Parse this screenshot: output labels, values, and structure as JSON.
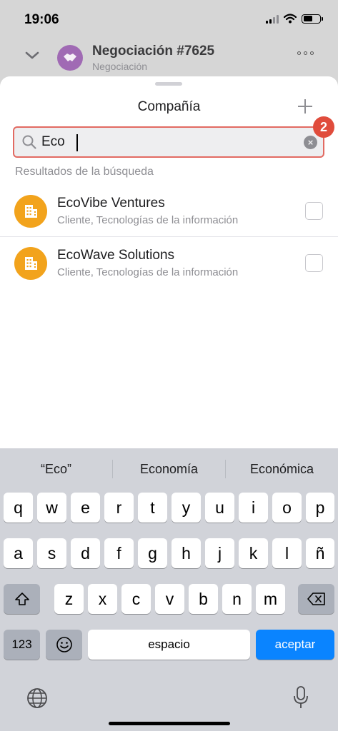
{
  "status_bar": {
    "time": "19:06"
  },
  "deal": {
    "title": "Negociación #7625",
    "subtitle": "Negociación",
    "avatar_color": "#a06ab4"
  },
  "sheet": {
    "title": "Compañía",
    "search": {
      "value": "Eco",
      "placeholder": ""
    },
    "badge": "2",
    "results_label": "Resultados de la búsqueda",
    "results": [
      {
        "name": "EcoVibe Ventures",
        "meta": "Cliente, Tecnologías de la información"
      },
      {
        "name": "EcoWave Solutions",
        "meta": "Cliente, Tecnologías de la información"
      }
    ]
  },
  "keyboard": {
    "suggestions": [
      "“Eco”",
      "Economía",
      "Económica"
    ],
    "row1": [
      "q",
      "w",
      "e",
      "r",
      "t",
      "y",
      "u",
      "i",
      "o",
      "p"
    ],
    "row2": [
      "a",
      "s",
      "d",
      "f",
      "g",
      "h",
      "j",
      "k",
      "l",
      "ñ"
    ],
    "row3": [
      "z",
      "x",
      "c",
      "v",
      "b",
      "n",
      "m"
    ],
    "numbers_key": "123",
    "space_key": "espacio",
    "return_key": "aceptar"
  },
  "colors": {
    "accent": "#0a84ff",
    "badge": "#e04c3c",
    "company_avatar": "#f2a31c",
    "search_border": "#e26a62"
  },
  "icons": [
    "search-icon",
    "clear-icon",
    "plus-icon",
    "building-icon",
    "chevron-down-icon",
    "more-icon",
    "shift-icon",
    "backspace-icon",
    "emoji-icon",
    "globe-icon",
    "mic-icon"
  ]
}
